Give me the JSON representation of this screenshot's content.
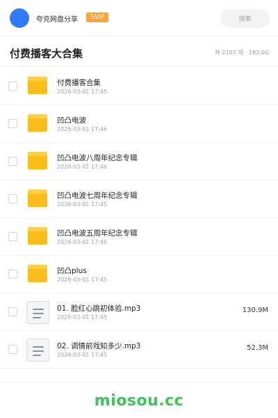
{
  "topbar": {
    "share_name": "夸克网盘分享",
    "badge": "SVIP",
    "search_placeholder": "搜索"
  },
  "header": {
    "title": "付费播客大合集",
    "summary": "共 2107 项 · 182.0G"
  },
  "files": [
    {
      "name": "付费播客合集",
      "date": "2026-03-01 17:45",
      "type": "folder",
      "size": ""
    },
    {
      "name": "凹凸电波",
      "date": "2026-03-01 17:46",
      "type": "folder",
      "size": ""
    },
    {
      "name": "凹凸电波八周年纪念专辑",
      "date": "2026-03-01 17:46",
      "type": "folder",
      "size": ""
    },
    {
      "name": "凹凸电波七周年纪念专辑",
      "date": "2026-03-01 17:45",
      "type": "folder",
      "size": ""
    },
    {
      "name": "凹凸电波五周年纪念专辑",
      "date": "2026-03-01 17:46",
      "type": "folder",
      "size": ""
    },
    {
      "name": "凹凸plus",
      "date": "2026-03-01 17:45",
      "type": "folder",
      "size": ""
    },
    {
      "name": "01. 脸红心跳初体验.mp3",
      "date": "2026-03-01 17:45",
      "type": "file",
      "size": "130.9M"
    },
    {
      "name": "02. 调情前戏知多少.mp3",
      "date": "2026-03-01 17:45",
      "type": "file",
      "size": "52.3M"
    }
  ],
  "footer": {
    "watermark": "miosou.cc"
  },
  "colors": {
    "avatar": "#2f7cf6",
    "badge": "#f7a43b",
    "folder": "#fbbd1a",
    "watermark": "#3ec25b"
  }
}
